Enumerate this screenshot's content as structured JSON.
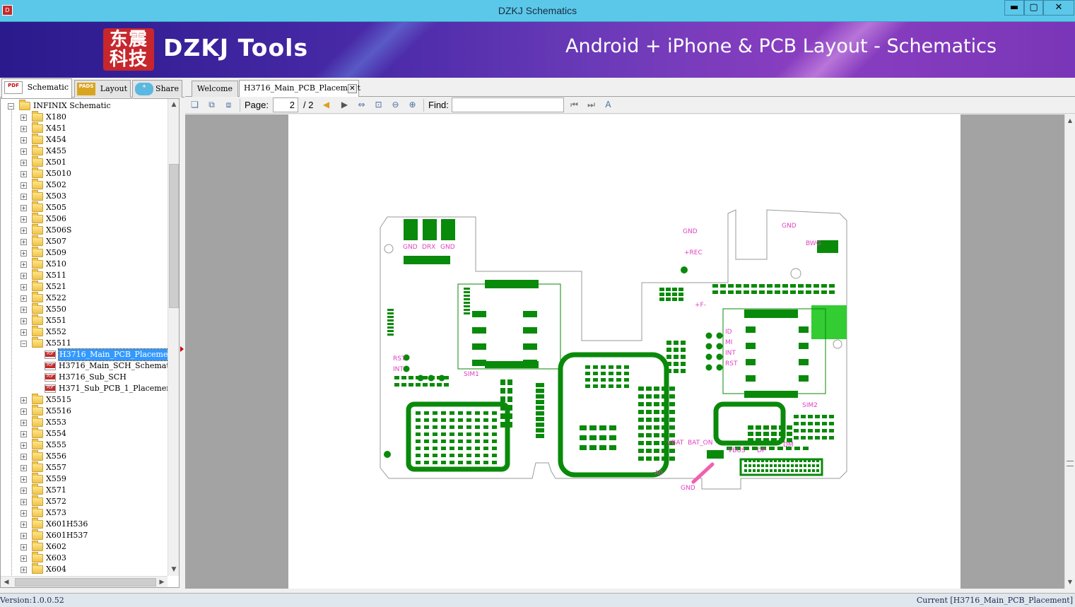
{
  "window": {
    "title": "DZKJ Schematics",
    "minimize_glyph": "▬",
    "maximize_glyph": "▢",
    "close_glyph": "✕"
  },
  "banner": {
    "logo_text": "东震科技",
    "brand": "DZKJ Tools",
    "tagline": "Android + iPhone & PCB Layout - Schematics"
  },
  "left_tabs": [
    {
      "label": "Schematic",
      "icon": "pdf-icon",
      "icon_text": "PDF"
    },
    {
      "label": "Layout",
      "icon": "pads-icon",
      "icon_text": "PADS"
    },
    {
      "label": "Share",
      "icon": "cloud-share-icon",
      "icon_text": "+"
    }
  ],
  "tree": {
    "root": "INFINIX Schematic",
    "folders": [
      "X180",
      "X451",
      "X454",
      "X455",
      "X501",
      "X5010",
      "X502",
      "X503",
      "X505",
      "X506",
      "X506S",
      "X507",
      "X509",
      "X510",
      "X511",
      "X521",
      "X522",
      "X550",
      "X551",
      "X552",
      "X5511",
      "X5515",
      "X5516",
      "X553",
      "X554",
      "X555",
      "X556",
      "X557",
      "X559",
      "X571",
      "X572",
      "X573",
      "X601H536",
      "X601H537",
      "X602",
      "X603",
      "X604"
    ],
    "expanded_folder": "X5511",
    "files": [
      "H3716_Main_PCB_Placement",
      "H3716_Main_SCH_Schematics",
      "H3716_Sub_SCH",
      "H371_Sub_PCB_1_Placement"
    ],
    "selected_file": "H3716_Main_PCB_Placement"
  },
  "doc_tabs": [
    {
      "label": "Welcome"
    },
    {
      "label": "H3716_Main_PCB_Placement",
      "close": "✕"
    }
  ],
  "toolbar": {
    "page_label": "Page:",
    "page_current": "2",
    "page_total": "/ 2",
    "find_label": "Find:",
    "find_value": ""
  },
  "pcb": {
    "labels": [
      "GND",
      "DRX",
      "GND",
      "GND",
      "+REC",
      "GND",
      "BWG",
      "RST",
      "INT",
      "SIM1",
      "SIM2",
      "VBAT",
      "BAT_ON",
      "VBUS",
      "DP",
      "DM",
      "A0",
      "GND",
      "ID",
      "MI",
      "INT",
      "RST",
      "+F-"
    ],
    "colors": {
      "copper": "#0a8a0a",
      "silk": "#e040c0",
      "outline": "#9a9a9a",
      "fill": "#33cc33"
    }
  },
  "status": {
    "version": "Version:1.0.0.52",
    "current": "Current [H3716_Main_PCB_Placement]"
  }
}
